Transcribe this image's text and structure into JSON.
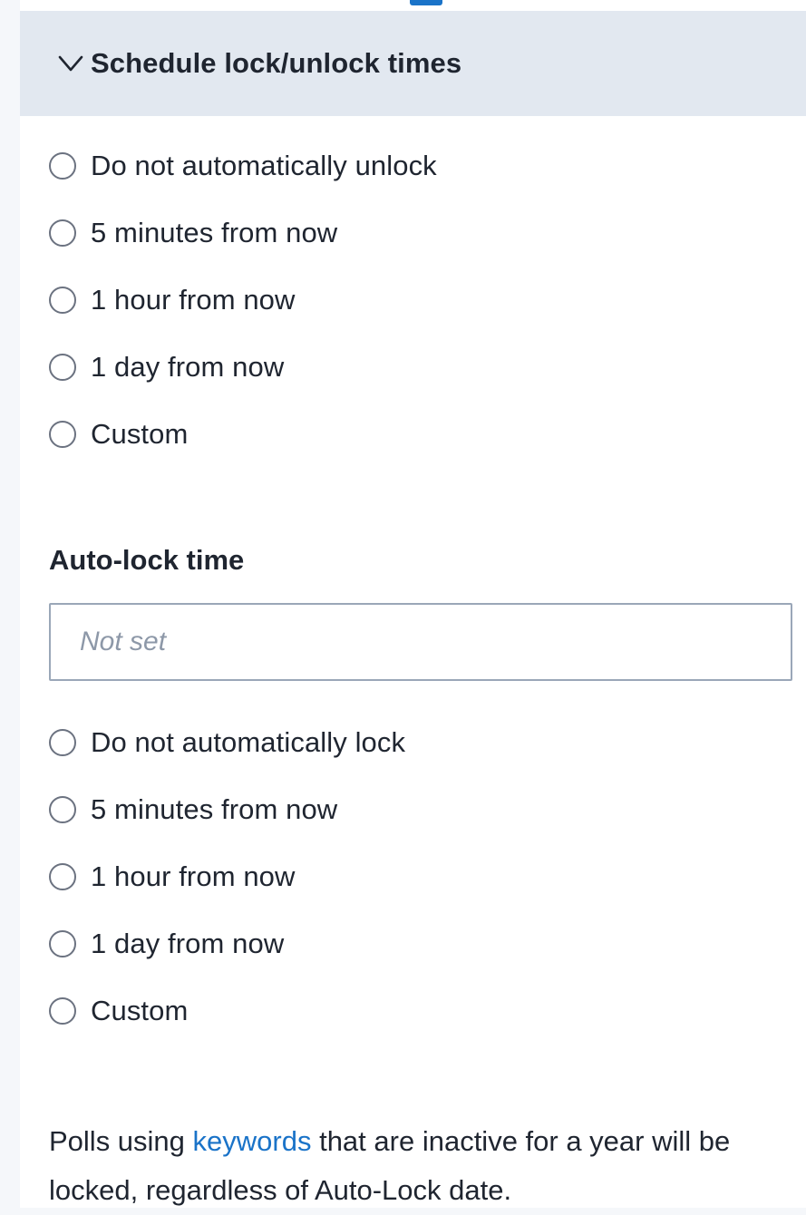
{
  "section": {
    "title": "Schedule lock/unlock times",
    "chevron_icon": "chevron-down-icon"
  },
  "unlock_options": [
    {
      "label": "Do not automatically unlock"
    },
    {
      "label": "5 minutes from now"
    },
    {
      "label": "1 hour from now"
    },
    {
      "label": "1 day from now"
    },
    {
      "label": "Custom"
    }
  ],
  "autolock": {
    "label": "Auto-lock time",
    "value": "",
    "placeholder": "Not set"
  },
  "lock_options": [
    {
      "label": "Do not automatically lock"
    },
    {
      "label": "5 minutes from now"
    },
    {
      "label": "1 hour from now"
    },
    {
      "label": "1 day from now"
    },
    {
      "label": "Custom"
    }
  ],
  "note": {
    "prefix": "Polls using ",
    "link": "keywords",
    "suffix": " that are inactive for a year will be locked, regardless of Auto-Lock date."
  },
  "colors": {
    "accent": "#1a73c8",
    "header_bg": "#e2e8f0",
    "text": "#1f2530",
    "placeholder": "#8d98a8"
  }
}
